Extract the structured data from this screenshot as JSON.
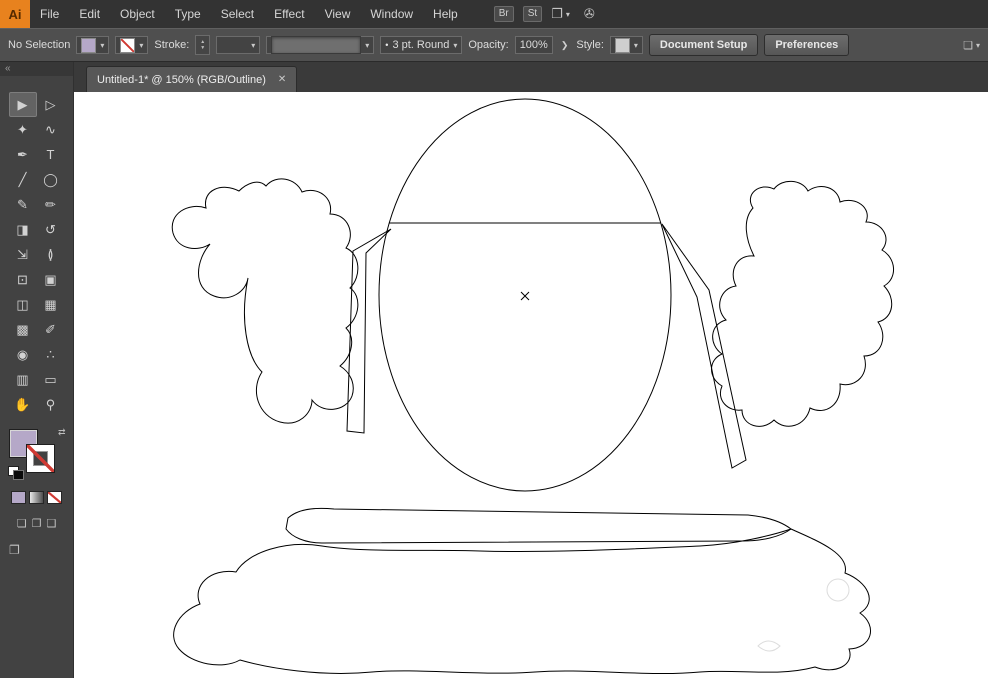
{
  "app": {
    "logo_text": "Ai"
  },
  "menubar": {
    "menus": [
      "File",
      "Edit",
      "Object",
      "Type",
      "Select",
      "Effect",
      "View",
      "Window",
      "Help"
    ],
    "br_label": "Br",
    "st_label": "St"
  },
  "icons": {
    "chevron_down": "▾",
    "chevron_right": "❯",
    "close": "✕",
    "collapse": "«",
    "swap": "⇄",
    "workspace": "❐",
    "cs_live": "✇",
    "stepper_up": "▲",
    "stepper_down": "▼",
    "bullet": "•",
    "arrange": "❏",
    "mode_normal": "❏",
    "mode_behind": "❐",
    "mode_inside": "❑",
    "screen_mode": "❐"
  },
  "control_bar": {
    "selection_status": "No Selection",
    "stroke_label": "Stroke:",
    "brush_name": "3 pt. Round",
    "opacity_label": "Opacity:",
    "opacity_value": "100%",
    "style_label": "Style:",
    "document_setup_label": "Document Setup",
    "preferences_label": "Preferences"
  },
  "tab": {
    "title": "Untitled-1* @ 150% (RGB/Outline)"
  },
  "toolbar": {
    "tools": [
      {
        "name": "selection",
        "glyph": "▶"
      },
      {
        "name": "direct-selection",
        "glyph": "▷"
      },
      {
        "name": "magic-wand",
        "glyph": "✦"
      },
      {
        "name": "lasso",
        "glyph": "∿"
      },
      {
        "name": "pen",
        "glyph": "✒"
      },
      {
        "name": "type",
        "glyph": "T"
      },
      {
        "name": "line-segment",
        "glyph": "╱"
      },
      {
        "name": "ellipse",
        "glyph": "◯"
      },
      {
        "name": "paintbrush",
        "glyph": "✎"
      },
      {
        "name": "pencil",
        "glyph": "✏"
      },
      {
        "name": "eraser",
        "glyph": "◨"
      },
      {
        "name": "rotate",
        "glyph": "↺"
      },
      {
        "name": "scale",
        "glyph": "⇲"
      },
      {
        "name": "width",
        "glyph": "≬"
      },
      {
        "name": "free-transform",
        "glyph": "⊡"
      },
      {
        "name": "shape-builder",
        "glyph": "▣"
      },
      {
        "name": "perspective-grid",
        "glyph": "◫"
      },
      {
        "name": "mesh",
        "glyph": "▦"
      },
      {
        "name": "gradient",
        "glyph": "▩"
      },
      {
        "name": "eyedropper",
        "glyph": "✐"
      },
      {
        "name": "blend",
        "glyph": "◉"
      },
      {
        "name": "symbol-sprayer",
        "glyph": "∴"
      },
      {
        "name": "column-graph",
        "glyph": "▥"
      },
      {
        "name": "artboard",
        "glyph": "▭"
      },
      {
        "name": "hand",
        "glyph": "✋"
      },
      {
        "name": "zoom",
        "glyph": "⚲"
      }
    ]
  },
  "swatches": {
    "fill_color": "#b5a8c8",
    "none_slash_color": "#d03a33"
  },
  "canvas": {
    "background": "#ffffff",
    "stroke_color": "#000000",
    "center_marker": "×",
    "view_mode": "Outline",
    "zoom_level": "150%"
  }
}
